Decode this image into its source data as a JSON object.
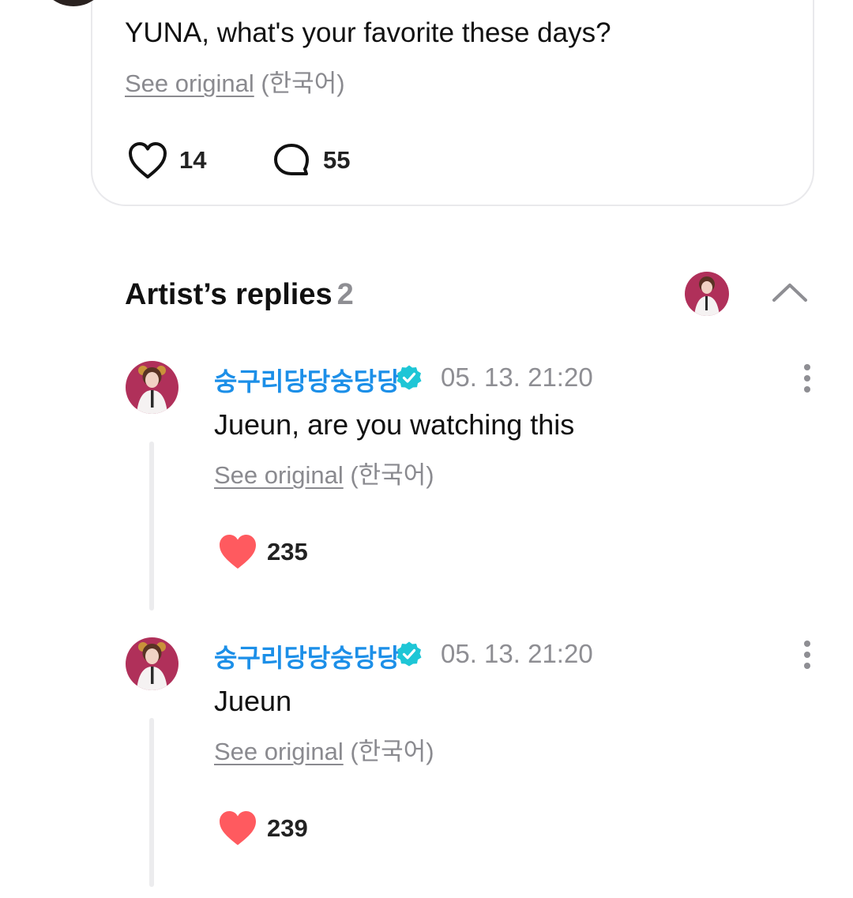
{
  "post": {
    "text": "YUNA, what's your favorite these days?",
    "see_original_link": "See original",
    "see_original_lang": "(한국어)",
    "like_count": "14",
    "comment_count": "55"
  },
  "artist_replies": {
    "title": "Artist’s replies",
    "count": "2"
  },
  "replies": [
    {
      "author": "숭구리당당숭당당",
      "timestamp": "05. 13. 21:20",
      "text": "Jueun, are you watching this",
      "see_original_link": "See original",
      "see_original_lang": "(한국어)",
      "like_count": "235"
    },
    {
      "author": "숭구리당당숭당당",
      "timestamp": "05. 13. 21:20",
      "text": "Jueun",
      "see_original_link": "See original",
      "see_original_lang": "(한국어)",
      "like_count": "239"
    }
  ],
  "icons": {
    "like_outline": "heart-outline-icon",
    "comment": "speech-bubble-icon",
    "like_filled": "heart-filled-icon",
    "verified": "verified-badge-icon",
    "more": "more-vertical-icon",
    "collapse": "chevron-up-icon"
  },
  "colors": {
    "artist_name": "#1c8fe8",
    "verified_badge": "#1ec6d6",
    "heart_filled": "#ff5a5f",
    "muted_text": "#8e8e93"
  }
}
